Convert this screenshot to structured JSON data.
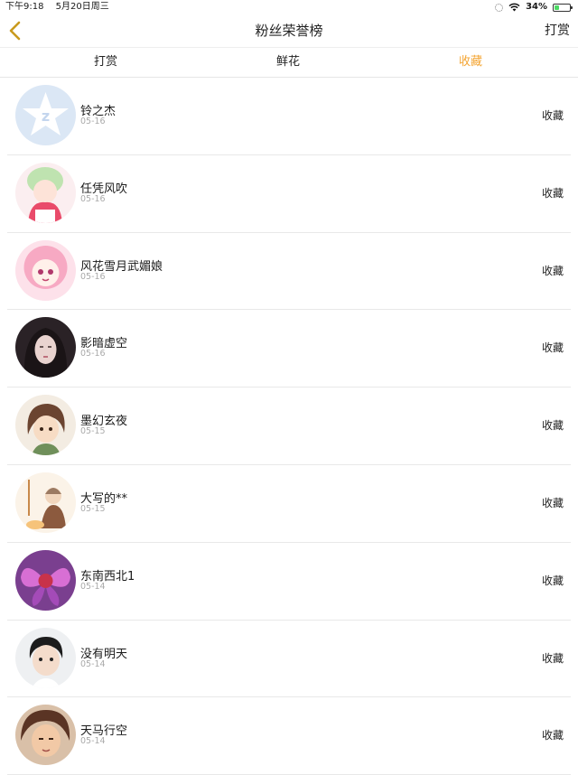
{
  "status_bar": {
    "time": "下午9:18",
    "date": "5月20日周三",
    "battery_text": "34%",
    "battery_level": 0.34,
    "wifi_icon": "wifi-icon",
    "loading_icon": "activity-spinner-icon"
  },
  "nav": {
    "back_icon": "chevron-left-icon",
    "title": "粉丝荣誉榜",
    "right_action": "打赏"
  },
  "tabs": [
    {
      "label": "打赏",
      "active": false
    },
    {
      "label": "鲜花",
      "active": false
    },
    {
      "label": "收藏",
      "active": true
    }
  ],
  "colors": {
    "accent": "#f4a533",
    "battery_green": "#4cd964",
    "divider": "#e8e8e8",
    "date_gray": "#aaaaaa"
  },
  "list": [
    {
      "name": "铃之杰",
      "date": "05-16",
      "action": "收藏"
    },
    {
      "name": "任凭风吹",
      "date": "05-16",
      "action": "收藏"
    },
    {
      "name": "风花雪月武媚娘",
      "date": "05-16",
      "action": "收藏"
    },
    {
      "name": "影暗虚空",
      "date": "05-16",
      "action": "收藏"
    },
    {
      "name": "墨幻玄夜",
      "date": "05-15",
      "action": "收藏"
    },
    {
      "name": "大写的**",
      "date": "05-15",
      "action": "收藏"
    },
    {
      "name": "东南西北1",
      "date": "05-14",
      "action": "收藏"
    },
    {
      "name": "没有明天",
      "date": "05-14",
      "action": "收藏"
    },
    {
      "name": "天马行空",
      "date": "05-14",
      "action": "收藏"
    }
  ]
}
